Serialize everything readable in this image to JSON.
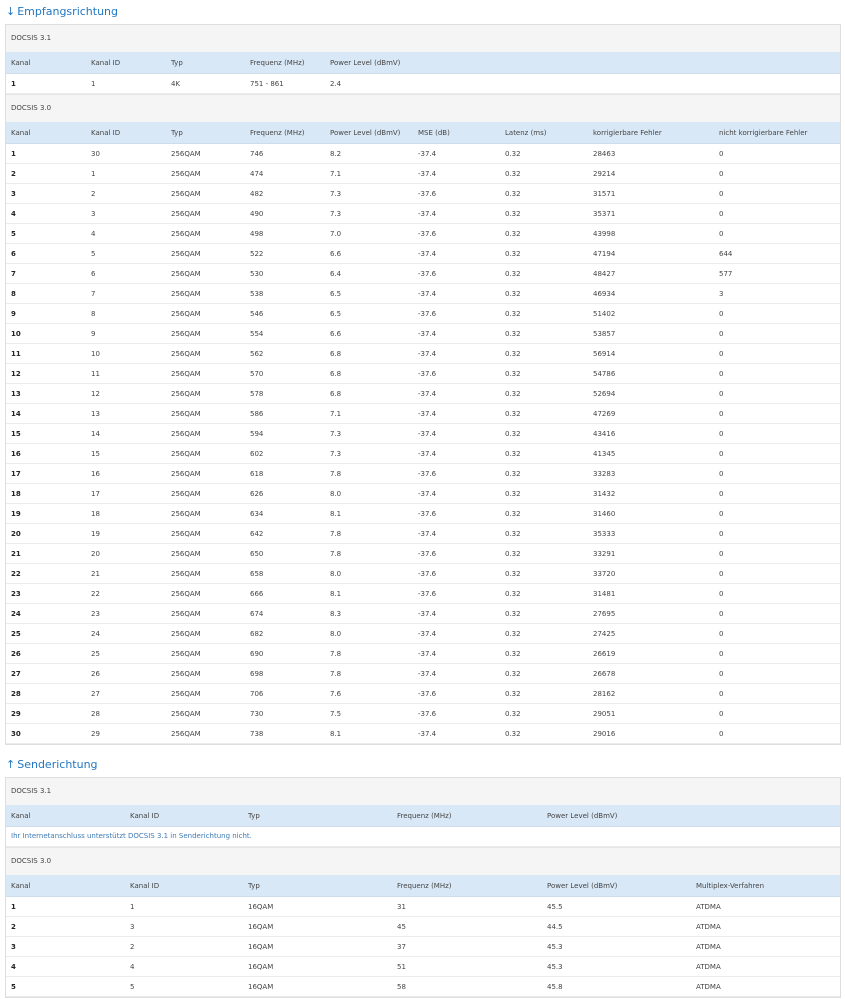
{
  "downstream": {
    "title": "Empfangsrichtung",
    "arrow": "↓",
    "docsis31": {
      "title": "DOCSIS 3.1",
      "headers": [
        "Kanal",
        "Kanal ID",
        "Typ",
        "Frequenz (MHz)",
        "Power Level (dBmV)"
      ],
      "rows": [
        [
          "1",
          "1",
          "4K",
          "751 - 861",
          "2.4"
        ]
      ]
    },
    "docsis30": {
      "title": "DOCSIS 3.0",
      "headers": [
        "Kanal",
        "Kanal ID",
        "Typ",
        "Frequenz (MHz)",
        "Power Level (dBmV)",
        "MSE (dB)",
        "Latenz (ms)",
        "korrigierbare Fehler",
        "nicht korrigierbare Fehler"
      ],
      "rows": [
        [
          "1",
          "30",
          "256QAM",
          "746",
          "8.2",
          "-37.4",
          "0.32",
          "28463",
          "0"
        ],
        [
          "2",
          "1",
          "256QAM",
          "474",
          "7.1",
          "-37.4",
          "0.32",
          "29214",
          "0"
        ],
        [
          "3",
          "2",
          "256QAM",
          "482",
          "7.3",
          "-37.6",
          "0.32",
          "31571",
          "0"
        ],
        [
          "4",
          "3",
          "256QAM",
          "490",
          "7.3",
          "-37.4",
          "0.32",
          "35371",
          "0"
        ],
        [
          "5",
          "4",
          "256QAM",
          "498",
          "7.0",
          "-37.6",
          "0.32",
          "43998",
          "0"
        ],
        [
          "6",
          "5",
          "256QAM",
          "522",
          "6.6",
          "-37.4",
          "0.32",
          "47194",
          "644"
        ],
        [
          "7",
          "6",
          "256QAM",
          "530",
          "6.4",
          "-37.6",
          "0.32",
          "48427",
          "577"
        ],
        [
          "8",
          "7",
          "256QAM",
          "538",
          "6.5",
          "-37.4",
          "0.32",
          "46934",
          "3"
        ],
        [
          "9",
          "8",
          "256QAM",
          "546",
          "6.5",
          "-37.6",
          "0.32",
          "51402",
          "0"
        ],
        [
          "10",
          "9",
          "256QAM",
          "554",
          "6.6",
          "-37.4",
          "0.32",
          "53857",
          "0"
        ],
        [
          "11",
          "10",
          "256QAM",
          "562",
          "6.8",
          "-37.4",
          "0.32",
          "56914",
          "0"
        ],
        [
          "12",
          "11",
          "256QAM",
          "570",
          "6.8",
          "-37.6",
          "0.32",
          "54786",
          "0"
        ],
        [
          "13",
          "12",
          "256QAM",
          "578",
          "6.8",
          "-37.4",
          "0.32",
          "52694",
          "0"
        ],
        [
          "14",
          "13",
          "256QAM",
          "586",
          "7.1",
          "-37.4",
          "0.32",
          "47269",
          "0"
        ],
        [
          "15",
          "14",
          "256QAM",
          "594",
          "7.3",
          "-37.4",
          "0.32",
          "43416",
          "0"
        ],
        [
          "16",
          "15",
          "256QAM",
          "602",
          "7.3",
          "-37.4",
          "0.32",
          "41345",
          "0"
        ],
        [
          "17",
          "16",
          "256QAM",
          "618",
          "7.8",
          "-37.6",
          "0.32",
          "33283",
          "0"
        ],
        [
          "18",
          "17",
          "256QAM",
          "626",
          "8.0",
          "-37.4",
          "0.32",
          "31432",
          "0"
        ],
        [
          "19",
          "18",
          "256QAM",
          "634",
          "8.1",
          "-37.6",
          "0.32",
          "31460",
          "0"
        ],
        [
          "20",
          "19",
          "256QAM",
          "642",
          "7.8",
          "-37.4",
          "0.32",
          "35333",
          "0"
        ],
        [
          "21",
          "20",
          "256QAM",
          "650",
          "7.8",
          "-37.6",
          "0.32",
          "33291",
          "0"
        ],
        [
          "22",
          "21",
          "256QAM",
          "658",
          "8.0",
          "-37.6",
          "0.32",
          "33720",
          "0"
        ],
        [
          "23",
          "22",
          "256QAM",
          "666",
          "8.1",
          "-37.6",
          "0.32",
          "31481",
          "0"
        ],
        [
          "24",
          "23",
          "256QAM",
          "674",
          "8.3",
          "-37.4",
          "0.32",
          "27695",
          "0"
        ],
        [
          "25",
          "24",
          "256QAM",
          "682",
          "8.0",
          "-37.4",
          "0.32",
          "27425",
          "0"
        ],
        [
          "26",
          "25",
          "256QAM",
          "690",
          "7.8",
          "-37.4",
          "0.32",
          "26619",
          "0"
        ],
        [
          "27",
          "26",
          "256QAM",
          "698",
          "7.8",
          "-37.4",
          "0.32",
          "26678",
          "0"
        ],
        [
          "28",
          "27",
          "256QAM",
          "706",
          "7.6",
          "-37.6",
          "0.32",
          "28162",
          "0"
        ],
        [
          "29",
          "28",
          "256QAM",
          "730",
          "7.5",
          "-37.6",
          "0.32",
          "29051",
          "0"
        ],
        [
          "30",
          "29",
          "256QAM",
          "738",
          "8.1",
          "-37.4",
          "0.32",
          "29016",
          "0"
        ]
      ]
    }
  },
  "upstream": {
    "title": "Senderichtung",
    "arrow": "↑",
    "docsis31": {
      "title": "DOCSIS 3.1",
      "headers": [
        "Kanal",
        "Kanal ID",
        "Typ",
        "Frequenz (MHz)",
        "Power Level (dBmV)"
      ],
      "info": "Ihr Internetanschluss unterstützt DOCSIS 3.1 in Senderichtung nicht."
    },
    "docsis30": {
      "title": "DOCSIS 3.0",
      "headers": [
        "Kanal",
        "Kanal ID",
        "Typ",
        "Frequenz (MHz)",
        "Power Level (dBmV)",
        "Multiplex-Verfahren"
      ],
      "rows": [
        [
          "1",
          "1",
          "16QAM",
          "31",
          "45.5",
          "ATDMA"
        ],
        [
          "2",
          "3",
          "16QAM",
          "45",
          "44.5",
          "ATDMA"
        ],
        [
          "3",
          "2",
          "16QAM",
          "37",
          "45.3",
          "ATDMA"
        ],
        [
          "4",
          "4",
          "16QAM",
          "51",
          "45.3",
          "ATDMA"
        ],
        [
          "5",
          "5",
          "16QAM",
          "58",
          "45.8",
          "ATDMA"
        ]
      ]
    }
  },
  "colors": {
    "accent": "#1f76c2",
    "header_bg": "#d9e8f6",
    "group_bg": "#f5f5f5"
  }
}
